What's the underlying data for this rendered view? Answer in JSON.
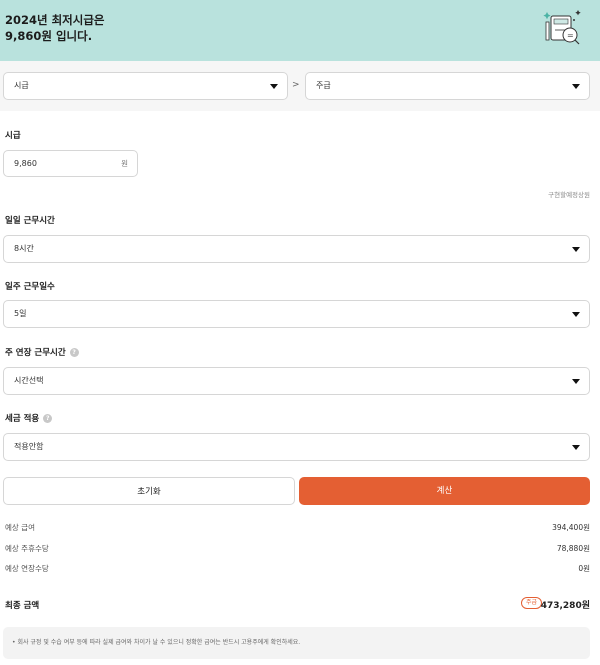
{
  "banner": {
    "line1": "2024년 최저시급은",
    "line2": "9,860원 입니다."
  },
  "unit_select": {
    "from": "시급",
    "to": "주급",
    "arrow": ">"
  },
  "wage": {
    "label": "시급",
    "value": "9,860",
    "unit": "원",
    "link": "구현할예정상원"
  },
  "daily_hours": {
    "label": "일일 근무시간",
    "value": "8시간"
  },
  "weekly_days": {
    "label": "일주 근무일수",
    "value": "5일"
  },
  "overtime": {
    "label": "주 연장 근무시간",
    "value": "시간선택",
    "info": "?"
  },
  "tax": {
    "label": "세금 적용",
    "value": "적용안함",
    "info": "?"
  },
  "buttons": {
    "reset": "초기화",
    "calc": "계산"
  },
  "results": [
    {
      "label": "예상 급여",
      "value": "394,400원"
    },
    {
      "label": "예상 주휴수당",
      "value": "78,880원"
    },
    {
      "label": "예상 연장수당",
      "value": "0원"
    }
  ],
  "total": {
    "label": "최종 금액",
    "badge": "주급",
    "value": "473,280원"
  },
  "notice": "• 회사 규정 및 수습 여부 등에 따라 실제 급여와 차이가 날 수 있으니 정확한 급여는 반드시 고용주에게 확인하세요.",
  "colors": {
    "banner": "#b9e2dd",
    "accent": "#e45f33"
  }
}
